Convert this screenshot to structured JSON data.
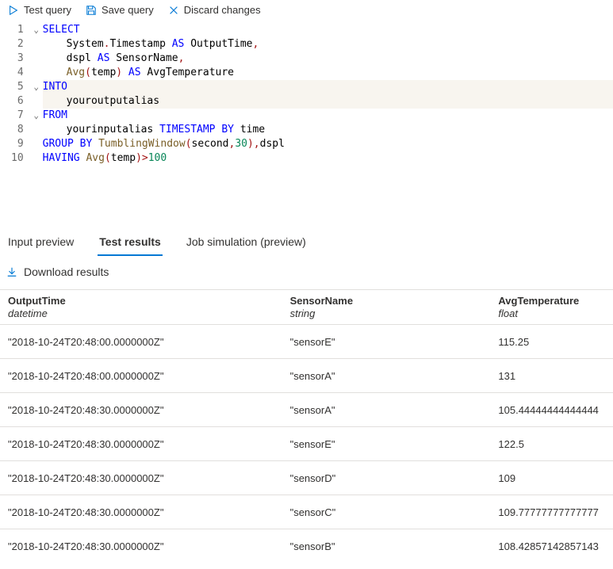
{
  "toolbar": {
    "test_label": "Test query",
    "save_label": "Save query",
    "discard_label": "Discard changes"
  },
  "editor": {
    "code": {
      "select_kw": "SELECT",
      "l2_a": "System",
      "l2_dot1": ".",
      "l2_b": "Timestamp",
      "l2_as": " AS ",
      "l2_c": "OutputTime",
      "l2_comma": ",",
      "l3_a": "dspl",
      "l3_as": " AS ",
      "l3_b": "SensorName",
      "l3_comma": ",",
      "l4_fn": "Avg",
      "l4_op": "(",
      "l4_arg": "temp",
      "l4_cp": ")",
      "l4_as": " AS ",
      "l4_b": "AvgTemperature",
      "into_kw": "INTO",
      "l6_a": "youroutputalias",
      "from_kw": "FROM",
      "l8_a": "yourinputalias",
      "l8_sp": " ",
      "l8_ts": "TIMESTAMP",
      "l8_by": " BY ",
      "l8_b": "time",
      "l9_grp": "GROUP BY",
      "l9_sp": " ",
      "l9_fn": "TumblingWindow",
      "l9_op": "(",
      "l9_arg1": "second",
      "l9_comma1": ",",
      "l9_num": "30",
      "l9_cp": ")",
      "l9_comma2": ",",
      "l9_arg2": "dspl",
      "l10_hav": "HAVING",
      "l10_sp": " ",
      "l10_fn": "Avg",
      "l10_op": "(",
      "l10_arg": "temp",
      "l10_cp": ")",
      "l10_gt": ">",
      "l10_num": "100"
    },
    "line_numbers": [
      "1",
      "2",
      "3",
      "4",
      "5",
      "6",
      "7",
      "8",
      "9",
      "10"
    ],
    "fold_markers": {
      "1": "⌄",
      "5": "⌄",
      "7": "⌄"
    }
  },
  "tabs": {
    "input_preview": "Input preview",
    "test_results": "Test results",
    "job_simulation": "Job simulation (preview)"
  },
  "download_label": "Download results",
  "results": {
    "columns": [
      {
        "name": "OutputTime",
        "type": "datetime"
      },
      {
        "name": "SensorName",
        "type": "string"
      },
      {
        "name": "AvgTemperature",
        "type": "float"
      }
    ],
    "rows": [
      {
        "OutputTime": "\"2018-10-24T20:48:00.0000000Z\"",
        "SensorName": "\"sensorE\"",
        "AvgTemperature": "115.25"
      },
      {
        "OutputTime": "\"2018-10-24T20:48:00.0000000Z\"",
        "SensorName": "\"sensorA\"",
        "AvgTemperature": "131"
      },
      {
        "OutputTime": "\"2018-10-24T20:48:30.0000000Z\"",
        "SensorName": "\"sensorA\"",
        "AvgTemperature": "105.44444444444444"
      },
      {
        "OutputTime": "\"2018-10-24T20:48:30.0000000Z\"",
        "SensorName": "\"sensorE\"",
        "AvgTemperature": "122.5"
      },
      {
        "OutputTime": "\"2018-10-24T20:48:30.0000000Z\"",
        "SensorName": "\"sensorD\"",
        "AvgTemperature": "109"
      },
      {
        "OutputTime": "\"2018-10-24T20:48:30.0000000Z\"",
        "SensorName": "\"sensorC\"",
        "AvgTemperature": "109.77777777777777"
      },
      {
        "OutputTime": "\"2018-10-24T20:48:30.0000000Z\"",
        "SensorName": "\"sensorB\"",
        "AvgTemperature": "108.42857142857143"
      }
    ]
  }
}
